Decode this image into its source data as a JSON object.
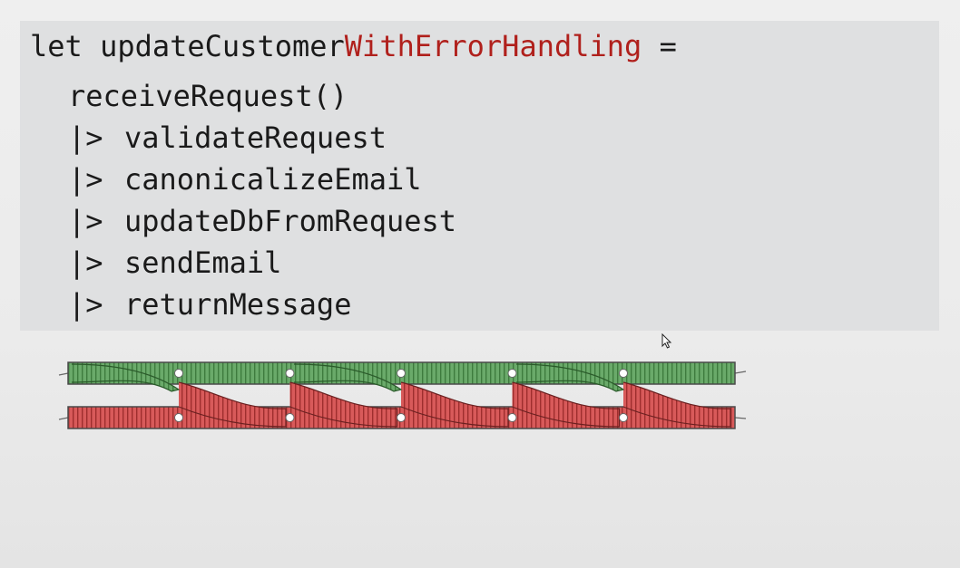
{
  "code": {
    "line1": {
      "keyword": "let",
      "name_prefix": "updateCustomer",
      "name_highlight": "WithErrorHandling",
      "equals": "="
    },
    "start": "receiveRequest()",
    "pipe_operator": "|>",
    "steps": [
      "validateRequest",
      "canonicalizeEmail",
      "updateDbFromRequest",
      "sendEmail",
      "returnMessage"
    ]
  },
  "diagram": {
    "success_track_color": "#5a9e5a",
    "failure_track_color": "#cc4b4b",
    "switch_count": 5
  },
  "colors": {
    "code_background": "#dfe0e1",
    "highlight": "#b0201c"
  }
}
